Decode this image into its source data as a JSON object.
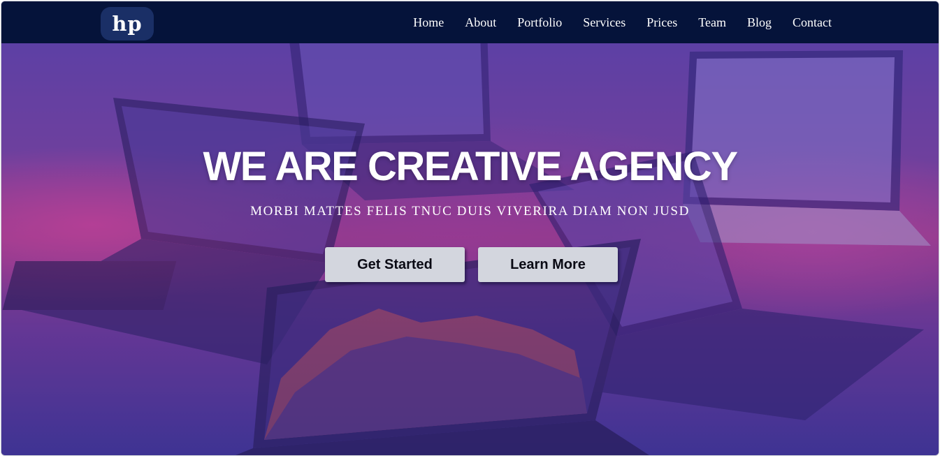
{
  "brand": {
    "logo_text": "hp"
  },
  "nav": {
    "items": [
      {
        "label": "Home"
      },
      {
        "label": "About"
      },
      {
        "label": "Portfolio"
      },
      {
        "label": "Services"
      },
      {
        "label": "Prices"
      },
      {
        "label": "Team"
      },
      {
        "label": "Blog"
      },
      {
        "label": "Contact"
      }
    ]
  },
  "hero": {
    "headline": "WE ARE CREATIVE AGENCY",
    "tagline": "MORBI MATTES FELIS TNUC DUIS VIVERIRA DIAM NON JUSD",
    "primary_button": "Get Started",
    "secondary_button": "Learn More"
  },
  "colors": {
    "navbar_bg": "#05133a",
    "logo_bg": "#1a2f66",
    "button_bg": "#d3d6de",
    "accent_pink": "#c04ea0",
    "accent_purple": "#5d4ab4"
  }
}
